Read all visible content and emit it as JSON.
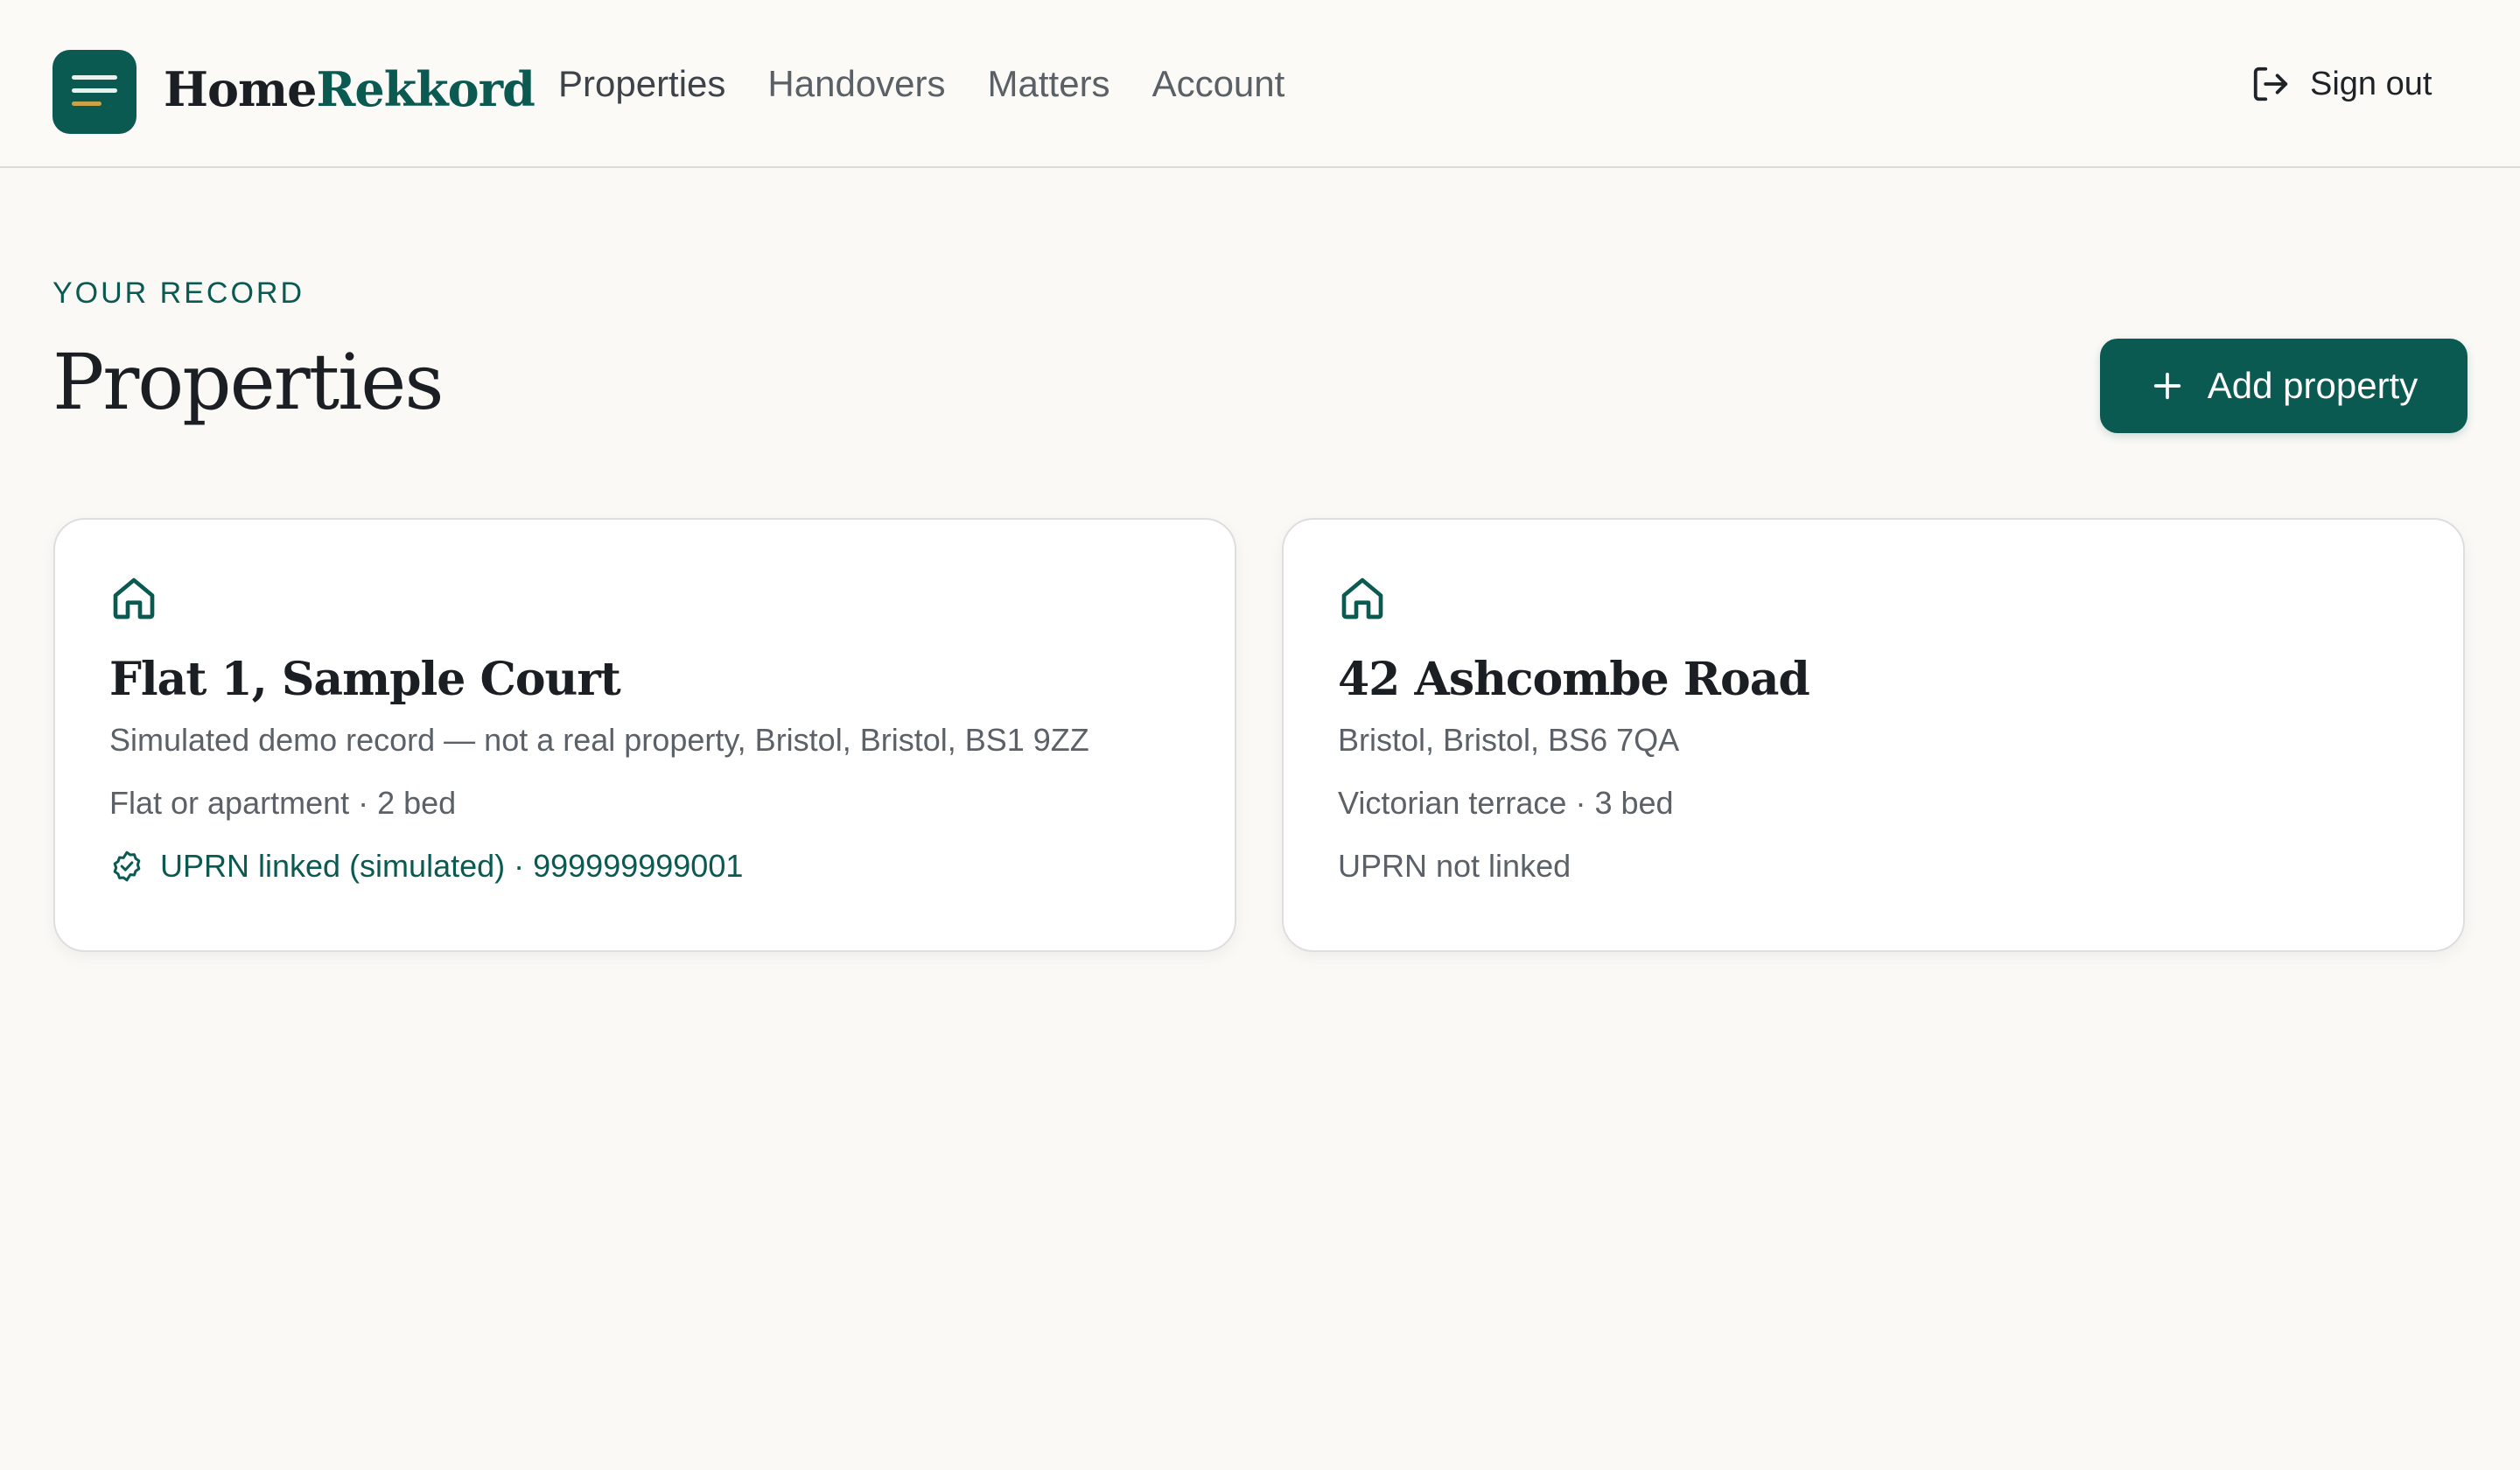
{
  "app": {
    "brand_part1": "Home",
    "brand_part2": "Rekkord",
    "accent_color": "#0b5a52"
  },
  "nav": {
    "items": [
      {
        "label": "Properties",
        "active": true
      },
      {
        "label": "Handovers",
        "active": false
      },
      {
        "label": "Matters",
        "active": false
      },
      {
        "label": "Account",
        "active": false
      }
    ]
  },
  "header": {
    "signout_label": "Sign out",
    "signout_icon": "sign-out-icon",
    "menu_icon": "menu-icon"
  },
  "page": {
    "eyebrow": "YOUR RECORD",
    "title": "Properties",
    "add_button_label": "Add property",
    "add_button_icon": "plus-icon"
  },
  "properties": [
    {
      "icon": "house-icon",
      "title": "Flat 1, Sample Court",
      "address": "Simulated demo record — not a real property, Bristol, Bristol, BS1 9ZZ",
      "meta": "Flat or apartment · 2 bed",
      "uprn_status": "UPRN linked (simulated) · 999999999001",
      "uprn_linked": true
    },
    {
      "icon": "house-icon",
      "title": "42 Ashcombe Road",
      "address": "Bristol, Bristol, BS6 7QA",
      "meta": "Victorian terrace · 3 bed",
      "uprn_status": "UPRN not linked",
      "uprn_linked": false
    }
  ]
}
